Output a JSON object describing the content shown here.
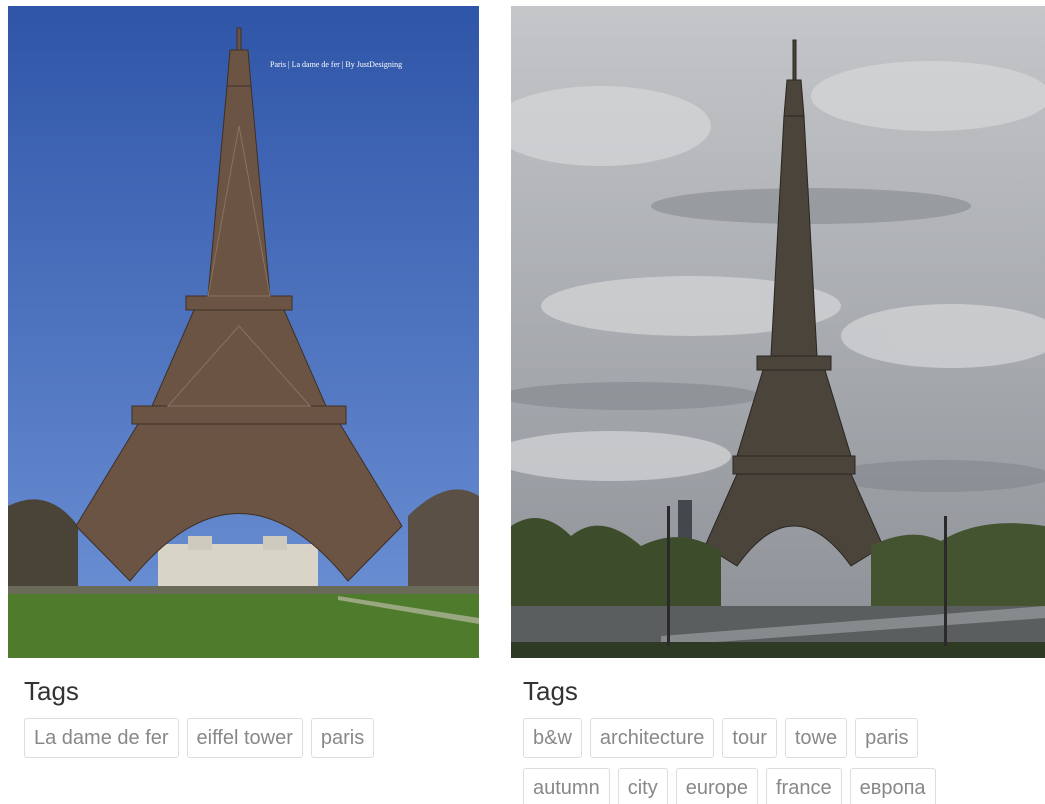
{
  "cards": [
    {
      "photo": {
        "alt": "Eiffel Tower against a clear blue sky",
        "watermark": "Paris | La dame de fer | By JustDesigning",
        "colors": {
          "sky": "#3a63b5",
          "grass": "#4a7a2a",
          "tower": "#5a4535"
        }
      },
      "tags_title": "Tags",
      "tags": [
        "La dame de fer",
        "eiffel tower",
        "paris"
      ]
    },
    {
      "photo": {
        "alt": "Eiffel Tower under a cloudy grey sky",
        "colors": {
          "sky": "#a9acb0",
          "trees": "#3d4a2a",
          "tower": "#3a3630"
        }
      },
      "tags_title": "Tags",
      "tags": [
        "b&w",
        "architecture",
        "tour",
        "towe",
        "paris",
        "autumn",
        "city",
        "europe",
        "france",
        "европа"
      ]
    }
  ]
}
